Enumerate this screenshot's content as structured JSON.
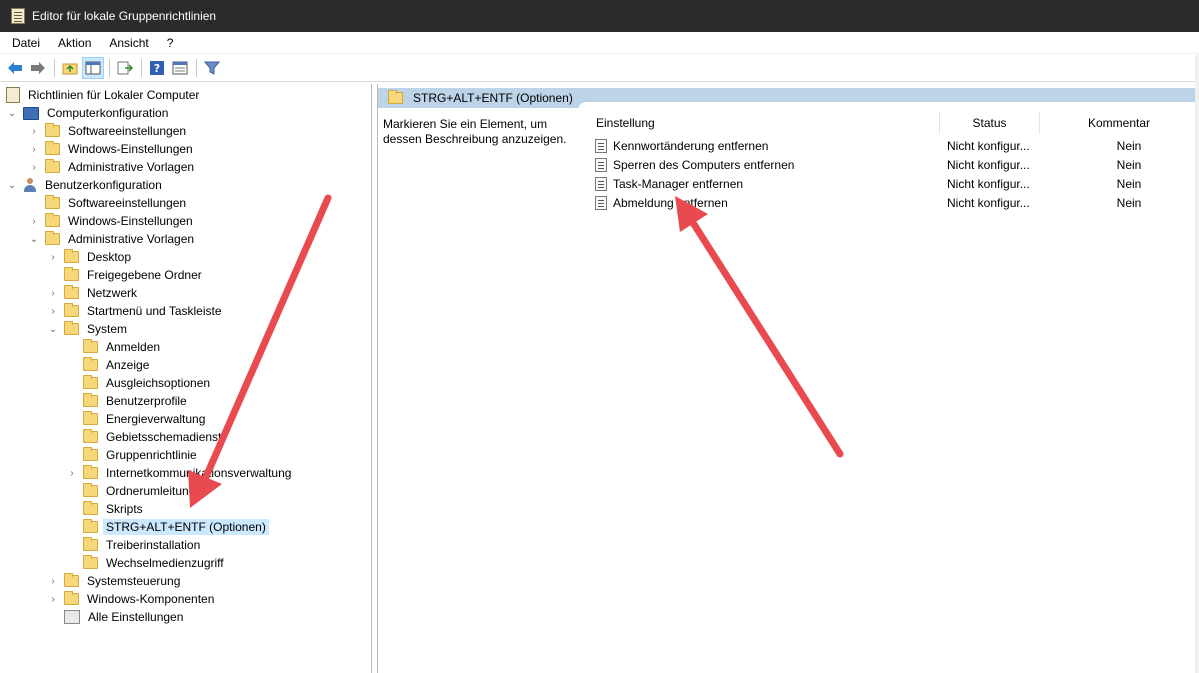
{
  "window": {
    "title": "Editor für lokale Gruppenrichtlinien"
  },
  "menu": [
    "Datei",
    "Aktion",
    "Ansicht",
    "?"
  ],
  "toolbar": {
    "buttons": [
      "back-arrow-icon",
      "forward-arrow-icon",
      "up-folder-icon",
      "show-hide-tree-icon",
      "export-list-icon",
      "help-icon",
      "properties-view-icon",
      "filter-icon"
    ]
  },
  "tree": {
    "root": "Richtlinien für Lokaler Computer",
    "computer_config": "Computerkonfiguration",
    "c_software": "Softwareeinstellungen",
    "c_windows": "Windows-Einstellungen",
    "c_admin": "Administrative Vorlagen",
    "user_config": "Benutzerkonfiguration",
    "u_software": "Softwareeinstellungen",
    "u_windows": "Windows-Einstellungen",
    "u_admin": "Administrative Vorlagen",
    "desktop": "Desktop",
    "freigegebene": "Freigegebene Ordner",
    "netzwerk": "Netzwerk",
    "startmenu": "Startmenü und Taskleiste",
    "system": "System",
    "anmelden": "Anmelden",
    "anzeige": "Anzeige",
    "ausgleich": "Ausgleichsoptionen",
    "benutzerprofile": "Benutzerprofile",
    "energie": "Energieverwaltung",
    "gebiet": "Gebietsschemadienst",
    "gruppen": "Gruppenrichtlinie",
    "internet": "Internetkommunikationsverwaltung",
    "ordnerumleitung": "Ordnerumleitung",
    "skripts": "Skripts",
    "strg": "STRG+ALT+ENTF (Optionen)",
    "treiber": "Treiberinstallation",
    "wechsel": "Wechselmedienzugriff",
    "systemsteuerung": "Systemsteuerung",
    "windows_komp": "Windows-Komponenten",
    "alle": "Alle Einstellungen"
  },
  "right": {
    "header_title": "STRG+ALT+ENTF (Optionen)",
    "description": "Markieren Sie ein Element, um dessen Beschreibung anzuzeigen.",
    "columns": {
      "einstellung": "Einstellung",
      "status": "Status",
      "kommentar": "Kommentar"
    },
    "rows": [
      {
        "name": "Kennwortänderung entfernen",
        "status": "Nicht konfigur...",
        "comment": "Nein"
      },
      {
        "name": "Sperren des Computers entfernen",
        "status": "Nicht konfigur...",
        "comment": "Nein"
      },
      {
        "name": "Task-Manager entfernen",
        "status": "Nicht konfigur...",
        "comment": "Nein"
      },
      {
        "name": "Abmeldung entfernen",
        "status": "Nicht konfigur...",
        "comment": "Nein"
      }
    ]
  },
  "colors": {
    "selection": "#cce8ff",
    "header_bar": "#bcd3e8",
    "titlebar": "#2b2b2b",
    "annotation_arrow": "#e84a4f"
  }
}
